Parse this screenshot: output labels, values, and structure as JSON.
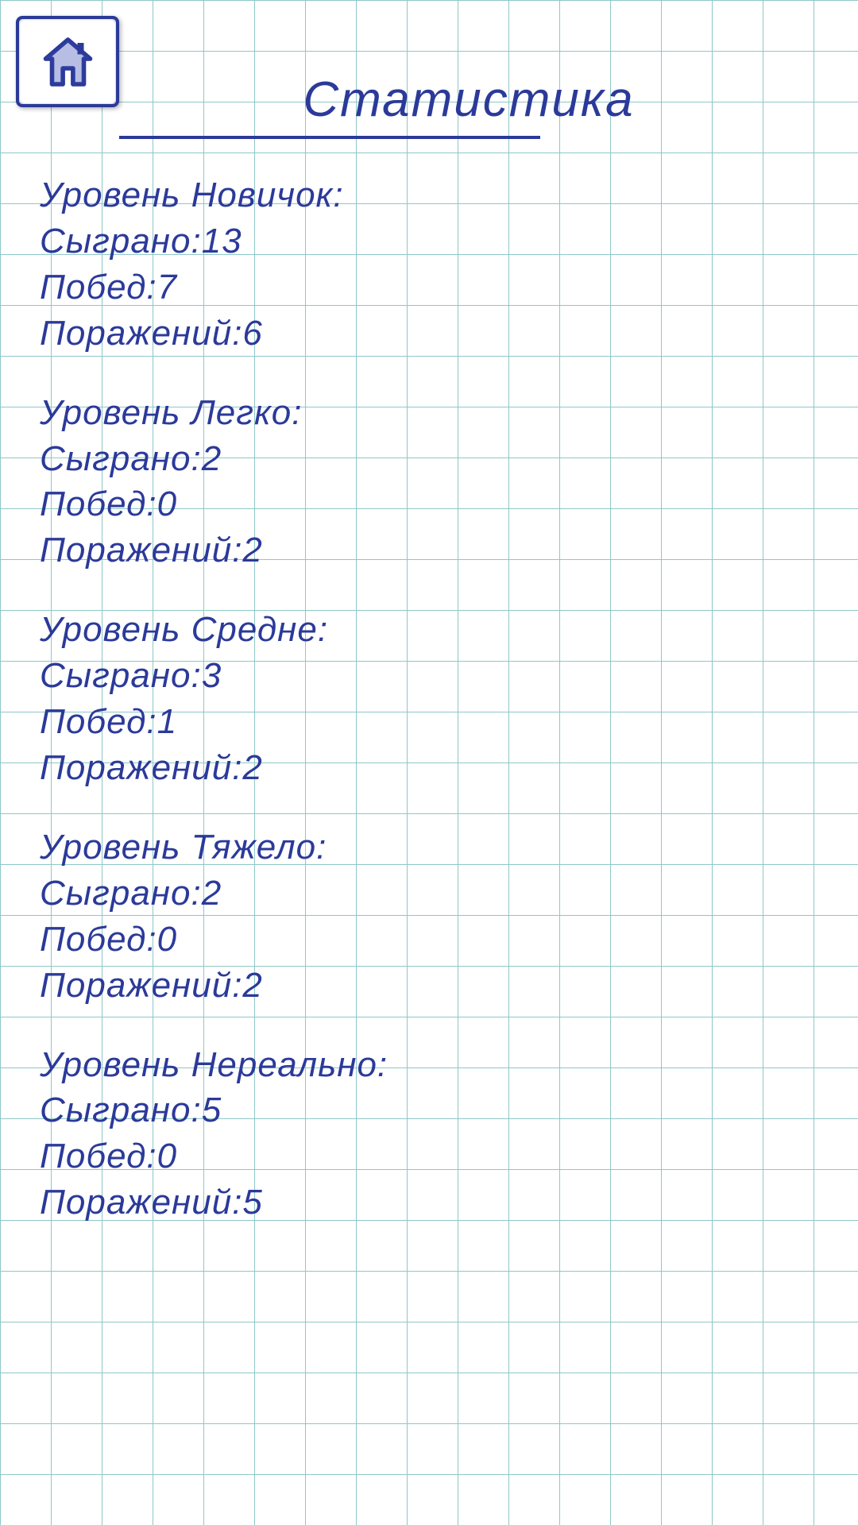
{
  "title": "Статистика",
  "labels": {
    "level_prefix": "Уровень",
    "played": "Сыграно",
    "wins": "Побед",
    "losses": "Поражений"
  },
  "levels": [
    {
      "name": "Новичок",
      "played": 13,
      "wins": 7,
      "losses": 6
    },
    {
      "name": "Легко",
      "played": 2,
      "wins": 0,
      "losses": 2
    },
    {
      "name": "Средне",
      "played": 3,
      "wins": 1,
      "losses": 2
    },
    {
      "name": "Тяжело",
      "played": 2,
      "wins": 0,
      "losses": 2
    },
    {
      "name": "Нереально",
      "played": 5,
      "wins": 0,
      "losses": 5
    }
  ]
}
